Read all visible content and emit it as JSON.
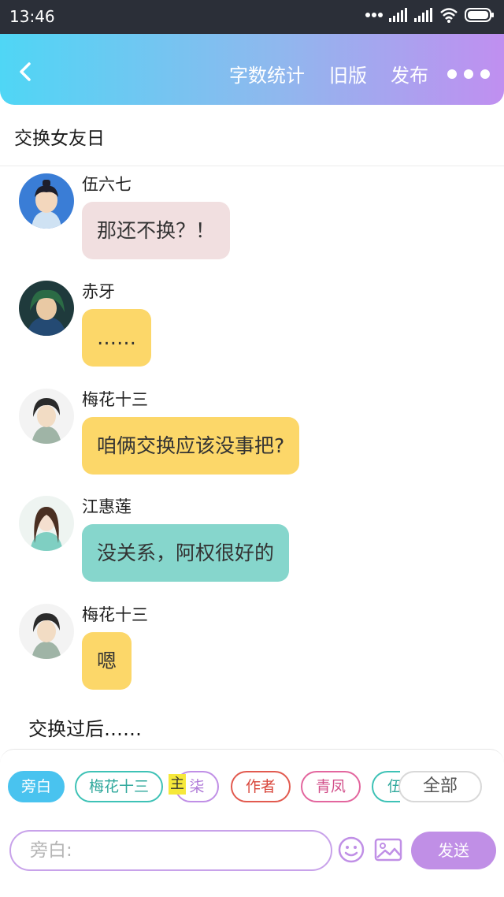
{
  "status_bar": {
    "time": "13:46"
  },
  "header": {
    "actions": [
      {
        "label": "字数统计"
      },
      {
        "label": "旧版"
      },
      {
        "label": "发布"
      }
    ]
  },
  "story": {
    "title": "交换女友日"
  },
  "messages": [
    {
      "name": "伍六七",
      "text": "那还不换？！",
      "bubble_color": "#f1dfe0"
    },
    {
      "name": "赤牙",
      "text": "……",
      "bubble_color": "#fcd769"
    },
    {
      "name": "梅花十三",
      "text": "咱俩交换应该没事把?",
      "bubble_color": "#fcd769"
    },
    {
      "name": "江惠莲",
      "text": "没关系，阿权很好的",
      "bubble_color": "#86d6cc"
    },
    {
      "name": "梅花十三",
      "text": "嗯",
      "bubble_color": "#fcd769"
    }
  ],
  "narration": "交换过后……",
  "role_bar": {
    "chips": [
      {
        "label": "旁白",
        "color": "#49c3ef",
        "selected": true
      },
      {
        "label": "梅花十三",
        "color": "#3ec2b6",
        "selected": false
      },
      {
        "label": "柒",
        "color": "#c08fe6",
        "selected": false
      },
      {
        "label": "作者",
        "color": "#e25a4f",
        "selected": false
      },
      {
        "label": "青凤",
        "color": "#e3669e",
        "selected": false
      },
      {
        "label": "伍",
        "color": "#3ec2b6",
        "selected": false
      }
    ],
    "main_tag": "主",
    "all_label": "全部"
  },
  "composer": {
    "placeholder": "旁白:",
    "send_label": "发送"
  }
}
